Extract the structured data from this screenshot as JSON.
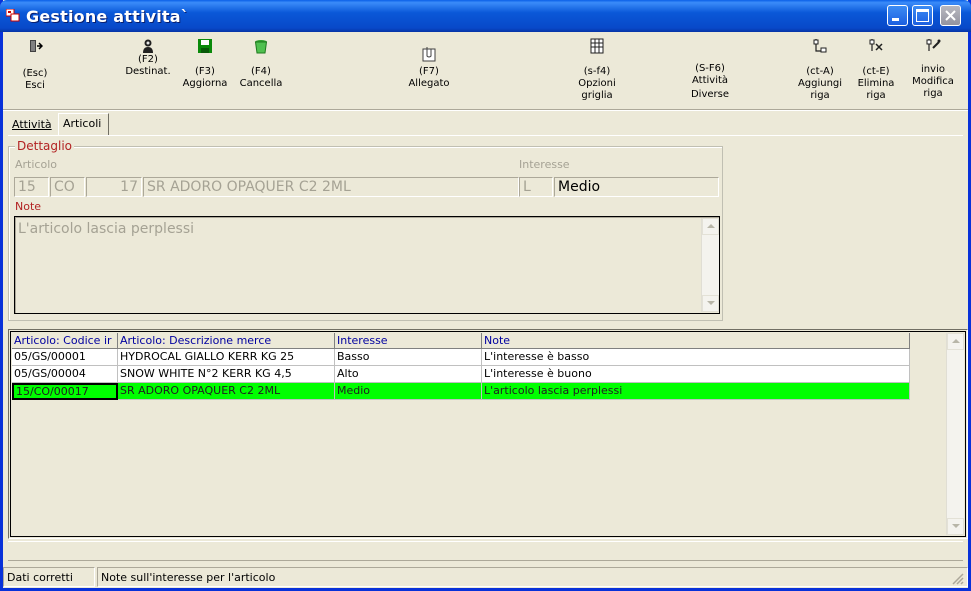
{
  "window": {
    "title": "Gestione attivita`",
    "colors": {
      "titlebar": "#0A58D8",
      "accent_red": "#B22222",
      "selected_row": "#00FF00",
      "header_text": "#0000A0"
    }
  },
  "toolbar": [
    {
      "key": "(Esc)",
      "label": "Esci",
      "icon": "exit-door-icon"
    },
    {
      "key": "(F2)",
      "label": "Destinat.",
      "icon": "person-icon"
    },
    {
      "key": "(F3)",
      "label": "Aggiorna",
      "icon": "save-disk-icon"
    },
    {
      "key": "(F4)",
      "label": "Cancella",
      "icon": "trash-icon"
    },
    {
      "key": "(F7)",
      "label": "Allegato",
      "icon": "attachment-icon"
    },
    {
      "key": "(s-f4)",
      "label": "Opzioni griglia",
      "label_line1": "Opzioni",
      "label_line2": "griglia",
      "icon": "grid-options-icon"
    },
    {
      "key": "(S-F6)",
      "label": "Attività Diverse",
      "label_line1": "Attività",
      "label_line2": "Diverse",
      "icon": ""
    },
    {
      "key": "(ct-A)",
      "label": "Aggiungi riga",
      "label_line1": "Aggiungi",
      "label_line2": "riga",
      "icon": "add-row-icon"
    },
    {
      "key": "(ct-E)",
      "label": "Elimina riga",
      "label_line1": "Elimina",
      "label_line2": "riga",
      "icon": "delete-row-icon"
    },
    {
      "key": "invio",
      "label": "Modifica riga",
      "label_line1": "Modifica",
      "label_line2": "riga",
      "icon": "edit-row-icon"
    }
  ],
  "tabs": [
    {
      "label": "Attività",
      "active": false
    },
    {
      "label": "Articoli",
      "active": true
    }
  ],
  "detail": {
    "legend": "Dettaglio",
    "articolo_label": "Articolo",
    "interesse_label": "Interesse",
    "note_label": "Note",
    "articolo_fields": [
      "15",
      "CO",
      "17",
      "SR ADORO OPAQUER C2 2ML"
    ],
    "interesse_code": "L",
    "interesse_value": "Medio",
    "note_value": "L'articolo lascia perplessi"
  },
  "grid": {
    "columns": [
      "Articolo: Codice ir",
      "Articolo: Descrizione merce",
      "Interesse",
      "Note"
    ],
    "rows": [
      [
        "05/GS/00001",
        "HYDROCAL GIALLO KERR KG 25",
        "Basso",
        "L'interesse è basso"
      ],
      [
        "05/GS/00004",
        "SNOW WHITE N°2 KERR KG 4,5",
        "Alto",
        "L'interesse è buono"
      ],
      [
        "15/CO/00017",
        "SR ADORO OPAQUER C2 2ML",
        "Medio",
        "L'articolo lascia perplessi"
      ]
    ],
    "selected_row": 2
  },
  "status": {
    "left": "Dati corretti",
    "right": "Note sull'interesse per l'articolo"
  }
}
